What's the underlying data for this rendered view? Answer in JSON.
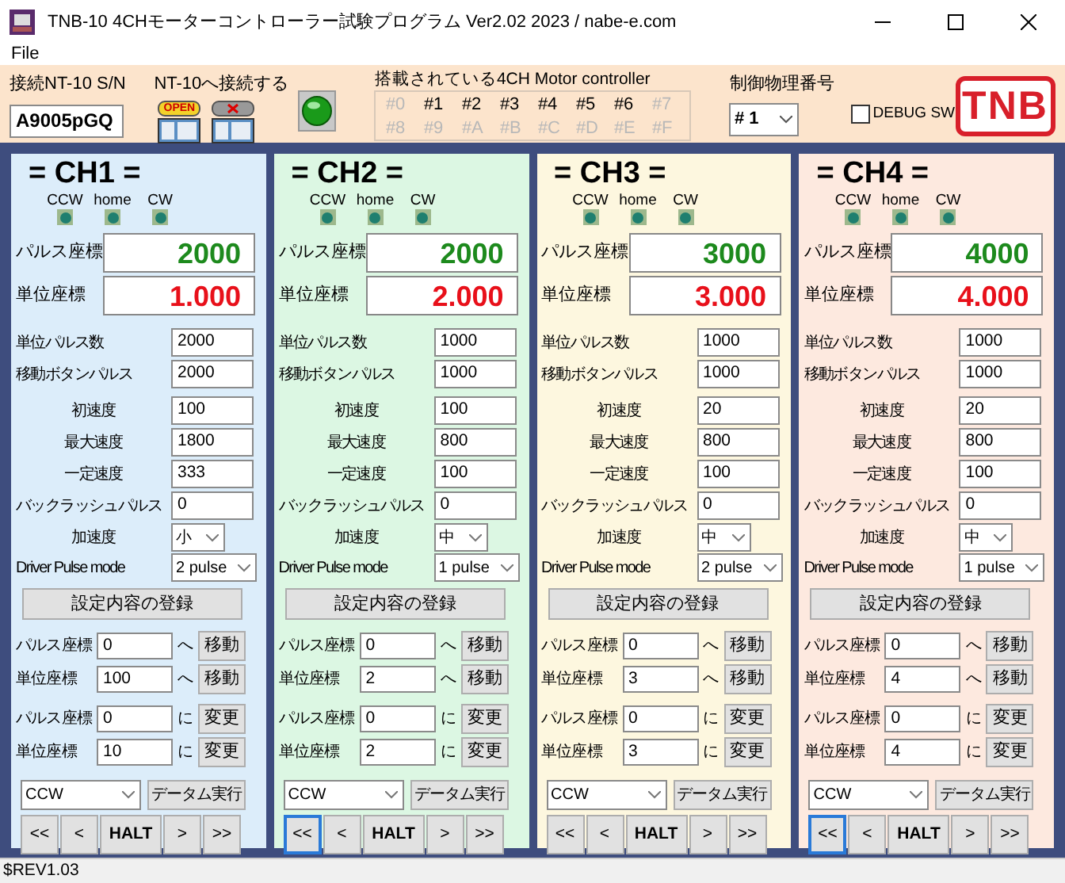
{
  "window": {
    "title": "TNB-10 4CHモーターコントローラー試験プログラム Ver2.02  2023 / nabe-e.com"
  },
  "menu": [
    "File"
  ],
  "toolbar": {
    "serial": {
      "label": "接続NT-10 S/N",
      "value": "A9005pGQ"
    },
    "connect": {
      "label": "NT-10へ接続する",
      "open_text": "OPEN"
    },
    "controllers": {
      "label": "搭載されている4CH Motor controller",
      "items": [
        {
          "label": "#0",
          "enabled": false
        },
        {
          "label": "#1",
          "enabled": true
        },
        {
          "label": "#2",
          "enabled": true
        },
        {
          "label": "#3",
          "enabled": true
        },
        {
          "label": "#4",
          "enabled": true
        },
        {
          "label": "#5",
          "enabled": true
        },
        {
          "label": "#6",
          "enabled": true
        },
        {
          "label": "#7",
          "enabled": false
        },
        {
          "label": "#8",
          "enabled": false
        },
        {
          "label": "#9",
          "enabled": false
        },
        {
          "label": "#A",
          "enabled": false
        },
        {
          "label": "#B",
          "enabled": false
        },
        {
          "label": "#C",
          "enabled": false
        },
        {
          "label": "#D",
          "enabled": false
        },
        {
          "label": "#E",
          "enabled": false
        },
        {
          "label": "#F",
          "enabled": false
        }
      ]
    },
    "physical": {
      "label": "制御物理番号",
      "value": "# 1"
    },
    "debug": {
      "label": "DEBUG SW",
      "checked": false
    },
    "logo": "TNB"
  },
  "channels": [
    {
      "title": "= CH1 =",
      "color": "#dcedfa",
      "limits": [
        "CCW",
        "home",
        "CW"
      ],
      "pulse": {
        "label": "パルス座標",
        "value": "2000"
      },
      "unit": {
        "label": "単位座標",
        "value": "1.000"
      },
      "params": [
        {
          "label": "単位パルス数",
          "value": "2000"
        },
        {
          "label": "移動ボタンパルス",
          "value": "2000"
        },
        {
          "label": "初速度",
          "value": "100"
        },
        {
          "label": "最大速度",
          "value": "1800"
        },
        {
          "label": "一定速度",
          "value": "333"
        },
        {
          "label": "バックラッシュパルス",
          "value": "0"
        }
      ],
      "accel": {
        "label": "加速度",
        "value": "小"
      },
      "pulse_mode": {
        "label": "Driver Pulse mode",
        "value": "2 pulse"
      },
      "register": "設定内容の登録",
      "moves": [
        {
          "label": "パルス座標",
          "value": "0",
          "suffix": "へ",
          "button": "移動"
        },
        {
          "label": "単位座標",
          "value": "100",
          "suffix": "へ",
          "button": "移動"
        },
        {
          "label": "パルス座標",
          "value": "0",
          "suffix": "に",
          "button": "変更"
        },
        {
          "label": "単位座標",
          "value": "10",
          "suffix": "に",
          "button": "変更"
        }
      ],
      "datum": {
        "value": "CCW",
        "button": "データム実行"
      },
      "jog": [
        {
          "label": "<<",
          "focused": false
        },
        {
          "label": "<",
          "focused": false
        },
        {
          "label": "HALT",
          "focused": false
        },
        {
          "label": ">",
          "focused": false
        },
        {
          "label": ">>",
          "focused": false
        }
      ]
    },
    {
      "title": "= CH2 =",
      "color": "#dcf7e3",
      "limits": [
        "CCW",
        "home",
        "CW"
      ],
      "pulse": {
        "label": "パルス座標",
        "value": "2000"
      },
      "unit": {
        "label": "単位座標",
        "value": "2.000"
      },
      "params": [
        {
          "label": "単位パルス数",
          "value": "1000"
        },
        {
          "label": "移動ボタンパルス",
          "value": "1000"
        },
        {
          "label": "初速度",
          "value": "100"
        },
        {
          "label": "最大速度",
          "value": "800"
        },
        {
          "label": "一定速度",
          "value": "100"
        },
        {
          "label": "バックラッシュパルス",
          "value": "0"
        }
      ],
      "accel": {
        "label": "加速度",
        "value": "中"
      },
      "pulse_mode": {
        "label": "Driver Pulse mode",
        "value": "1 pulse"
      },
      "register": "設定内容の登録",
      "moves": [
        {
          "label": "パルス座標",
          "value": "0",
          "suffix": "へ",
          "button": "移動"
        },
        {
          "label": "単位座標",
          "value": "2",
          "suffix": "へ",
          "button": "移動"
        },
        {
          "label": "パルス座標",
          "value": "0",
          "suffix": "に",
          "button": "変更"
        },
        {
          "label": "単位座標",
          "value": "2",
          "suffix": "に",
          "button": "変更"
        }
      ],
      "datum": {
        "value": "CCW",
        "button": "データム実行"
      },
      "jog": [
        {
          "label": "<<",
          "focused": true
        },
        {
          "label": "<",
          "focused": false
        },
        {
          "label": "HALT",
          "focused": false
        },
        {
          "label": ">",
          "focused": false
        },
        {
          "label": ">>",
          "focused": false
        }
      ]
    },
    {
      "title": "= CH3 =",
      "color": "#fdf7df",
      "limits": [
        "CCW",
        "home",
        "CW"
      ],
      "pulse": {
        "label": "パルス座標",
        "value": "3000"
      },
      "unit": {
        "label": "単位座標",
        "value": "3.000"
      },
      "params": [
        {
          "label": "単位パルス数",
          "value": "1000"
        },
        {
          "label": "移動ボタンパルス",
          "value": "1000"
        },
        {
          "label": "初速度",
          "value": "20"
        },
        {
          "label": "最大速度",
          "value": "800"
        },
        {
          "label": "一定速度",
          "value": "100"
        },
        {
          "label": "バックラッシュパルス",
          "value": "0"
        }
      ],
      "accel": {
        "label": "加速度",
        "value": "中"
      },
      "pulse_mode": {
        "label": "Driver Pulse mode",
        "value": "2 pulse"
      },
      "register": "設定内容の登録",
      "moves": [
        {
          "label": "パルス座標",
          "value": "0",
          "suffix": "へ",
          "button": "移動"
        },
        {
          "label": "単位座標",
          "value": "3",
          "suffix": "へ",
          "button": "移動"
        },
        {
          "label": "パルス座標",
          "value": "0",
          "suffix": "に",
          "button": "変更"
        },
        {
          "label": "単位座標",
          "value": "3",
          "suffix": "に",
          "button": "変更"
        }
      ],
      "datum": {
        "value": "CCW",
        "button": "データム実行"
      },
      "jog": [
        {
          "label": "<<",
          "focused": false
        },
        {
          "label": "<",
          "focused": false
        },
        {
          "label": "HALT",
          "focused": false
        },
        {
          "label": ">",
          "focused": false
        },
        {
          "label": ">>",
          "focused": false
        }
      ]
    },
    {
      "title": "= CH4 =",
      "color": "#fde9df",
      "limits": [
        "CCW",
        "home",
        "CW"
      ],
      "pulse": {
        "label": "パルス座標",
        "value": "4000"
      },
      "unit": {
        "label": "単位座標",
        "value": "4.000"
      },
      "params": [
        {
          "label": "単位パルス数",
          "value": "1000"
        },
        {
          "label": "移動ボタンパルス",
          "value": "1000"
        },
        {
          "label": "初速度",
          "value": "20"
        },
        {
          "label": "最大速度",
          "value": "800"
        },
        {
          "label": "一定速度",
          "value": "100"
        },
        {
          "label": "バックラッシュパルス",
          "value": "0"
        }
      ],
      "accel": {
        "label": "加速度",
        "value": "中"
      },
      "pulse_mode": {
        "label": "Driver Pulse mode",
        "value": "1 pulse"
      },
      "register": "設定内容の登録",
      "moves": [
        {
          "label": "パルス座標",
          "value": "0",
          "suffix": "へ",
          "button": "移動"
        },
        {
          "label": "単位座標",
          "value": "4",
          "suffix": "へ",
          "button": "移動"
        },
        {
          "label": "パルス座標",
          "value": "0",
          "suffix": "に",
          "button": "変更"
        },
        {
          "label": "単位座標",
          "value": "4",
          "suffix": "に",
          "button": "変更"
        }
      ],
      "datum": {
        "value": "CCW",
        "button": "データム実行"
      },
      "jog": [
        {
          "label": "<<",
          "focused": true
        },
        {
          "label": "<",
          "focused": false
        },
        {
          "label": "HALT",
          "focused": false
        },
        {
          "label": ">",
          "focused": false
        },
        {
          "label": ">>",
          "focused": false
        }
      ]
    }
  ],
  "status_bar": "$REV1.03"
}
